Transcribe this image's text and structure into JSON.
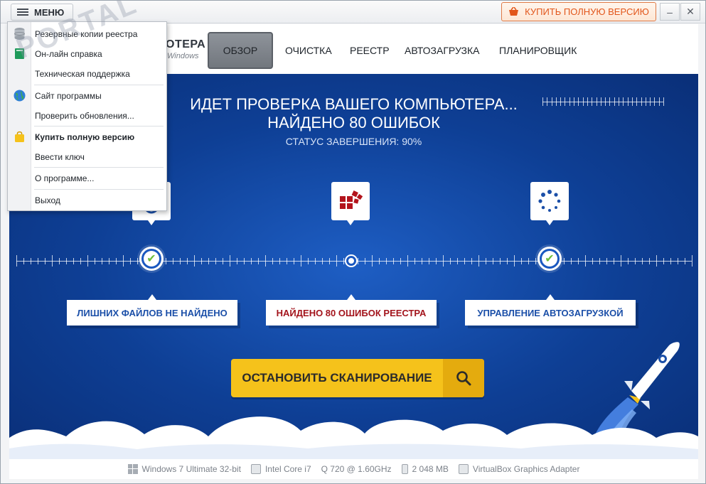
{
  "titlebar": {
    "menu_label": "МЕНЮ",
    "buy_label": "КУПИТЬ ПОЛНУЮ ВЕРСИЮ",
    "minimize_label": "–",
    "close_label": "✕"
  },
  "nav": {
    "logo_title": "ОТЕРА",
    "logo_subtitle": "Windows",
    "tabs": [
      {
        "label": "ОБЗОР",
        "active": true
      },
      {
        "label": "ОЧИСТКА",
        "active": false
      },
      {
        "label": "РЕЕСТР",
        "active": false
      },
      {
        "label": "АВТОЗАГРУЗКА",
        "active": false
      },
      {
        "label": "ПЛАНИРОВЩИК",
        "active": false
      }
    ]
  },
  "scan": {
    "title": "ИДЕТ ПРОВЕРКА ВАШЕГО КОМПЬЮТЕРА...",
    "errors_found": "НАЙДЕНО 80 ОШИБОК",
    "status": "СТАТУС ЗАВЕРШЕНИЯ: 90%",
    "progress_percent": 90
  },
  "results": [
    {
      "label": "ЛИШНИХ ФАЙЛОВ НЕ НАЙДЕНО",
      "color": "#1b4fa8",
      "icon": "files-icon",
      "state": "done"
    },
    {
      "label": "НАЙДЕНО 80 ОШИБОК РЕЕСТРА",
      "color": "#a3141c",
      "icon": "registry-blocks-icon",
      "state": "active"
    },
    {
      "label": "УПРАВЛЕНИЕ АВТОЗАГРУЗКОЙ",
      "color": "#1b4fa8",
      "icon": "spinner-icon",
      "state": "done"
    }
  ],
  "stop_button": {
    "label": "ОСТАНОВИТЬ СКАНИРОВАНИЕ",
    "icon": "search-icon"
  },
  "footer": {
    "os": "Windows 7 Ultimate 32-bit",
    "cpu": "Intel Core i7",
    "freq": "Q 720 @ 1.60GHz",
    "ram": "2 048 MB",
    "gpu": "VirtualBox Graphics Adapter"
  },
  "menu": {
    "items": [
      {
        "label": "Резервные копии реестра",
        "icon": "database-icon",
        "bold": false
      },
      {
        "label": "Он-лайн справка",
        "icon": "book-icon",
        "bold": false
      },
      {
        "label": "Техническая поддержка",
        "icon": "",
        "bold": false
      },
      {
        "label": "Сайт программы",
        "icon": "globe-icon",
        "bold": false
      },
      {
        "label": "Проверить обновления...",
        "icon": "",
        "bold": false
      },
      {
        "label": "Купить полную версию",
        "icon": "shopping-bag-icon",
        "bold": true
      },
      {
        "label": "Ввести ключ",
        "icon": "",
        "bold": false
      },
      {
        "label": "О программе...",
        "icon": "",
        "bold": false
      },
      {
        "label": "Выход",
        "icon": "",
        "bold": false
      }
    ]
  },
  "watermark": "PORTAL",
  "colors": {
    "main_blue": "#0e3f95",
    "accent_yellow": "#f5c21b",
    "error_red": "#a3141c",
    "buy_orange": "#e2561a"
  }
}
